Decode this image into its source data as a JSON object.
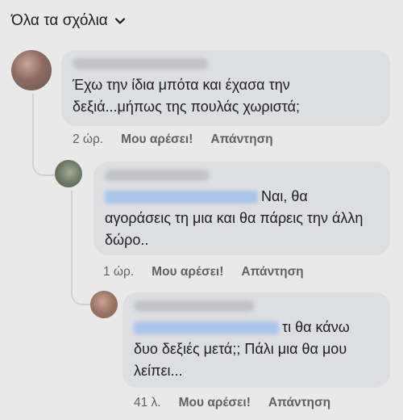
{
  "filter": {
    "label": "Όλα τα σχόλια"
  },
  "comments": [
    {
      "text": "Έχω την ίδια μπότα και έχασα την δεξιά...μήπως της πουλάς χωριστά;",
      "time": "2 ώρ.",
      "like": "Μου αρέσει!",
      "reply": "Απάντηση"
    },
    {
      "text": "Ναι, θα αγοράσεις τη μια και θα πάρεις την άλλη δώρο..",
      "time": "1 ώρ.",
      "like": "Μου αρέσει!",
      "reply": "Απάντηση"
    },
    {
      "text": "τι θα κάνω δυο δεξιές μετά;; Πάλι μια θα μου λείπει...",
      "time": "41 λ.",
      "like": "Μου αρέσει!",
      "reply": "Απάντηση"
    }
  ]
}
